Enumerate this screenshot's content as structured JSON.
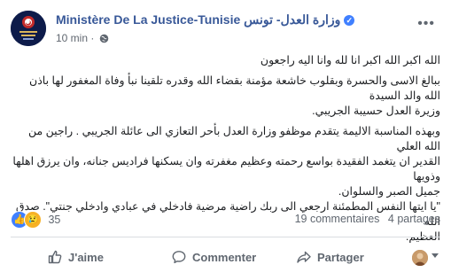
{
  "page": {
    "name": "Ministère De La Justice-Tunisie وزارة العدل- تونس",
    "time": "10 min",
    "privacy_sep": "·"
  },
  "post": {
    "lines": [
      "الله اكبر الله اكبر انا لله وانا اليه راجعون",
      "ببالغ الاسى والحسرة وبقلوب خاشعة مؤمنة بقضاء الله وقدره تلقينا نبأ وفاة المغفور لها باذن الله والد السيدة",
      "وزيرة العدل حسيبة الجريبي.",
      "وبهذه المناسبة الاليمة يتقدم موظفو وزارة العدل بأحر التعازي الى عائلة الجريبي . راجين من الله العلي",
      "القدير ان يتغمد الفقيدة بواسع رحمته وعظيم مغفرته وان يسكنها فراديس جنانه، وان يرزق اهلها وذويها",
      "جميل الصبر والسلوان.",
      "\"يا ايتها النفس المطمئنة ارجعي الى ربك راضية مرضية فادخلي في عبادي وادخلي جنتي\". صدق الله",
      "العظيم."
    ]
  },
  "stats": {
    "reactions_count": "35",
    "comments": "19 commentaires",
    "shares": "4 partages"
  },
  "actions": {
    "like": "J'aime",
    "comment": "Commenter",
    "share": "Partager"
  },
  "colors": {
    "link": "#385898",
    "accent": "#4080ff"
  }
}
